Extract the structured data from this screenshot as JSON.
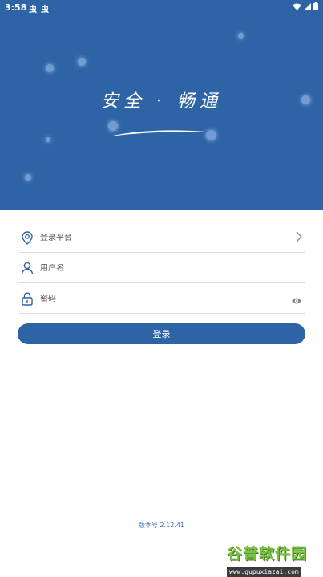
{
  "status_bar": {
    "time": "3:58",
    "notif_icons": [
      "虫",
      "虫"
    ]
  },
  "hero": {
    "slogan": "安全 · 畅通"
  },
  "form": {
    "platform": {
      "placeholder": "登录平台"
    },
    "username": {
      "placeholder": "用户名"
    },
    "password": {
      "placeholder": "密码"
    },
    "login_label": "登录"
  },
  "version": "版本号 2.12.41",
  "watermark": {
    "title": "谷普软件园",
    "url": "www.gupuxiazai.com"
  },
  "colors": {
    "brand": "#2e63a6",
    "divider": "#dcdcdc"
  }
}
